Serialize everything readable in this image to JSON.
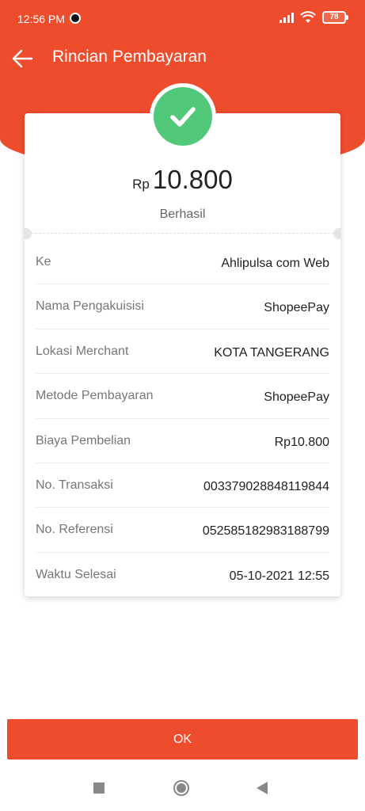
{
  "status_bar": {
    "time": "12:56 PM",
    "battery": "78"
  },
  "header": {
    "title": "Rincian Pembayaran",
    "back_icon": "arrow-left-icon"
  },
  "summary": {
    "currency_prefix": "Rp",
    "amount": "10.800",
    "status": "Berhasil",
    "status_icon": "check-icon",
    "status_color": "#51c87a"
  },
  "details": [
    {
      "label": "Ke",
      "value": "Ahlipulsa com Web"
    },
    {
      "label": "Nama Pengakuisisi",
      "value": "ShopeePay"
    },
    {
      "label": "Lokasi Merchant",
      "value": "KOTA TANGERANG"
    },
    {
      "label": "Metode Pembayaran",
      "value": "ShopeePay"
    },
    {
      "label": "Biaya Pembelian",
      "value": "Rp10.800"
    },
    {
      "label": "No. Transaksi",
      "value": "003379028848119844"
    },
    {
      "label": "No. Referensi",
      "value": "052585182983188799"
    },
    {
      "label": "Waktu Selesai",
      "value": "05-10-2021 12:55"
    }
  ],
  "ok_button": "OK",
  "colors": {
    "brand": "#ee4d2d"
  }
}
